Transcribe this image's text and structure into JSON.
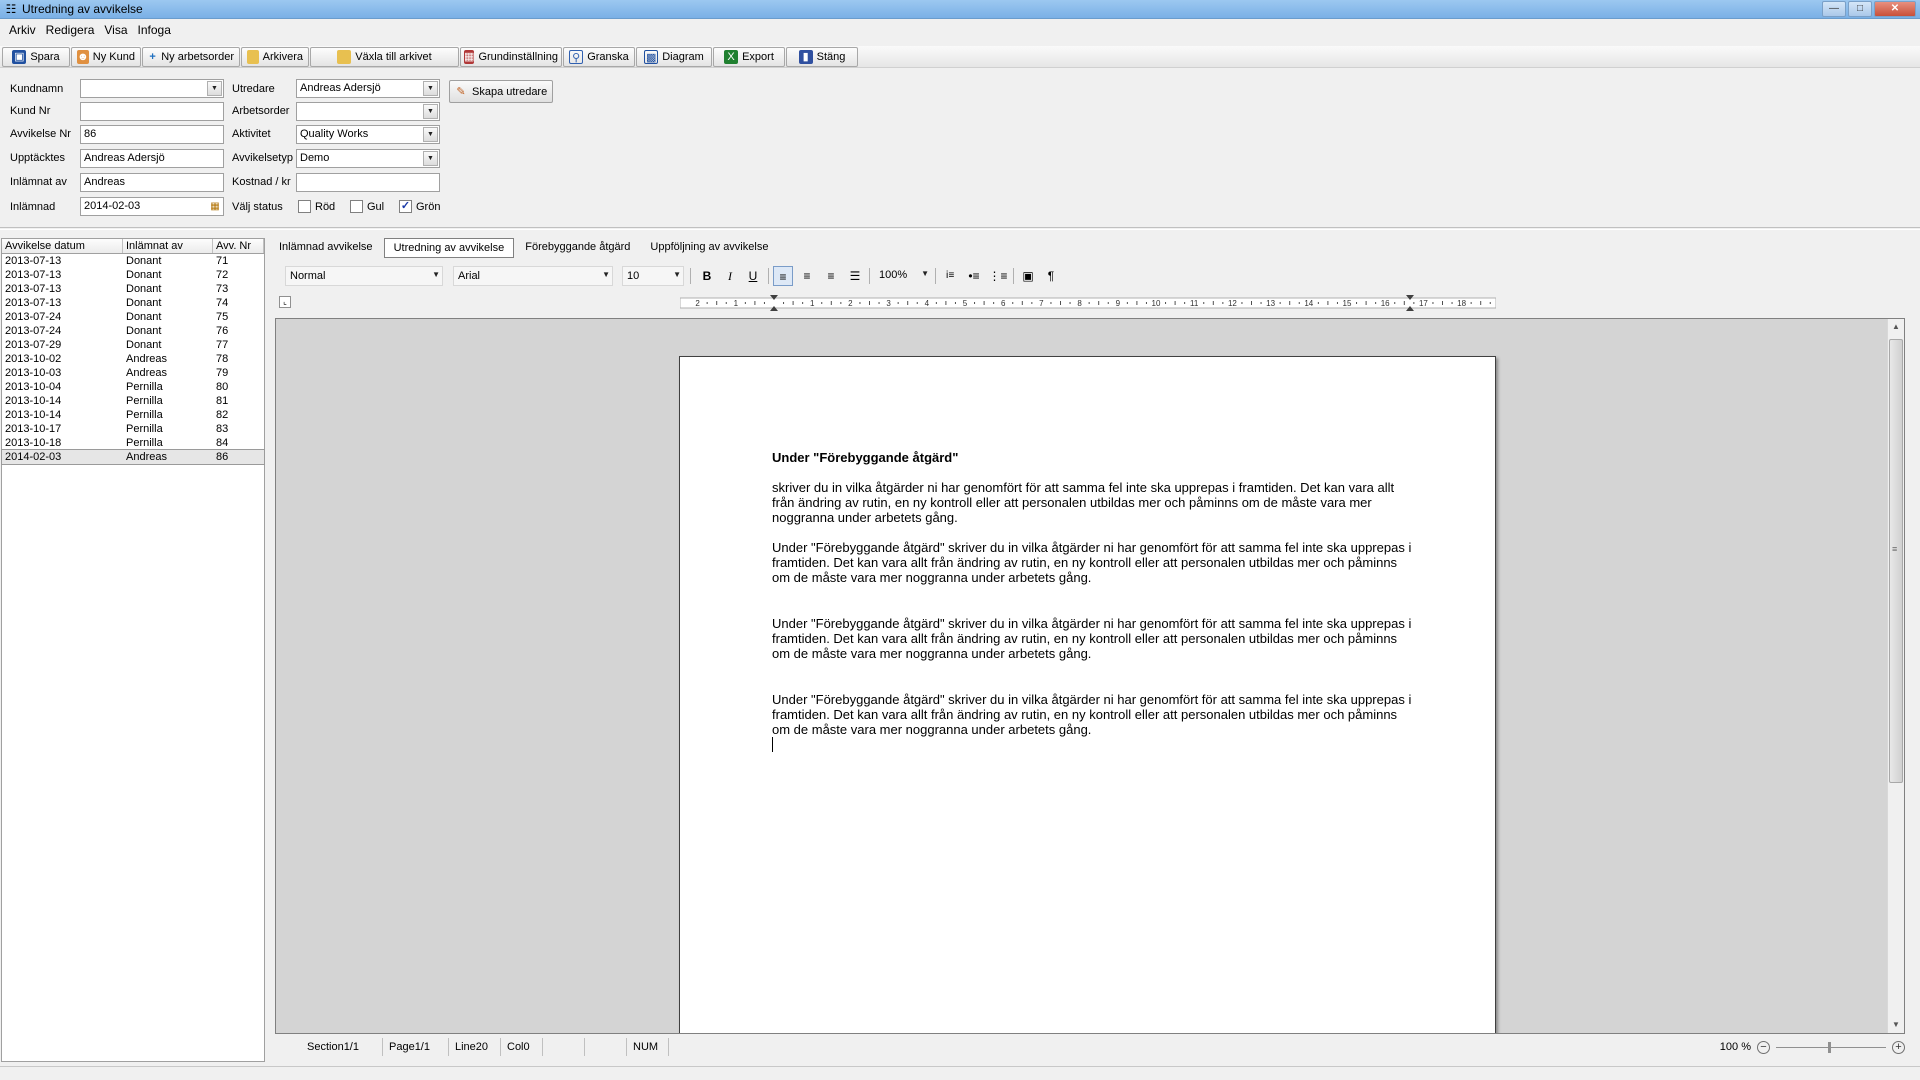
{
  "window": {
    "title": "Utredning av avvikelse",
    "app_icon": "document-search-icon",
    "controls": {
      "minimize": "minimize-icon",
      "maximize": "maximize-icon",
      "close": "close-icon"
    }
  },
  "menu": [
    "Arkiv",
    "Redigera",
    "Visa",
    "Infoga"
  ],
  "toolbar": [
    {
      "label": "Spara",
      "icon": "floppy-disk-icon",
      "color": "#2050a0"
    },
    {
      "label": "Ny Kund",
      "icon": "users-icon",
      "color": "#c06020"
    },
    {
      "label": "Ny arbetsorder",
      "icon": "plus-icon",
      "color": "#2070c0"
    },
    {
      "label": "Arkivera",
      "icon": "folder-icon",
      "color": "#d0a020"
    },
    {
      "label": "Växla till arkivet",
      "icon": "folder-open-icon",
      "color": "#d0a020"
    },
    {
      "label": "Grundinställning",
      "icon": "settings-book-icon",
      "color": "#a03030"
    },
    {
      "label": "Granska",
      "icon": "magnifier-icon",
      "color": "#3060b0"
    },
    {
      "label": "Diagram",
      "icon": "chart-icon",
      "color": "#2050a0"
    },
    {
      "label": "Export",
      "icon": "excel-icon",
      "color": "#208030"
    },
    {
      "label": "Stäng",
      "icon": "exit-door-icon",
      "color": "#3050a0"
    }
  ],
  "form": {
    "kundnamn": {
      "label": "Kundnamn",
      "value": ""
    },
    "kund_nr": {
      "label": "Kund Nr",
      "value": ""
    },
    "avvikelse_nr": {
      "label": "Avvikelse Nr",
      "value": "86"
    },
    "upptacktes": {
      "label": "Upptäcktes",
      "value": "Andreas Adersjö"
    },
    "inlamnat_av": {
      "label": "Inlämnat av",
      "value": "Andreas"
    },
    "inlamnad": {
      "label": "Inlämnad",
      "value": "2014-02-03"
    },
    "utredare": {
      "label": "Utredare",
      "value": "Andreas Adersjö"
    },
    "arbetsorder": {
      "label": "Arbetsorder",
      "value": ""
    },
    "aktivitet": {
      "label": "Aktivitet",
      "value": "Quality Works"
    },
    "avvikelsetyp": {
      "label": "Avvikelsetyp",
      "value": "Demo"
    },
    "kostnad": {
      "label": "Kostnad / kr",
      "value": ""
    },
    "status": {
      "label": "Välj status",
      "options": [
        {
          "label": "Röd",
          "checked": false
        },
        {
          "label": "Gul",
          "checked": false
        },
        {
          "label": "Grön",
          "checked": true
        }
      ]
    },
    "skapa_utredare": "Skapa utredare"
  },
  "list": {
    "headers": [
      "Avvikelse datum",
      "Inlämnat av",
      "Avv. Nr"
    ],
    "rows": [
      [
        "2013-07-13",
        "Donant",
        "71"
      ],
      [
        "2013-07-13",
        "Donant",
        "72"
      ],
      [
        "2013-07-13",
        "Donant",
        "73"
      ],
      [
        "2013-07-13",
        "Donant",
        "74"
      ],
      [
        "2013-07-24",
        "Donant",
        "75"
      ],
      [
        "2013-07-24",
        "Donant",
        "76"
      ],
      [
        "2013-07-29",
        "Donant",
        "77"
      ],
      [
        "2013-10-02",
        "Andreas",
        "78"
      ],
      [
        "2013-10-03",
        "Andreas",
        "79"
      ],
      [
        "2013-10-04",
        "Pernilla",
        "80"
      ],
      [
        "2013-10-14",
        "Pernilla",
        "81"
      ],
      [
        "2013-10-14",
        "Pernilla",
        "82"
      ],
      [
        "2013-10-17",
        "Pernilla",
        "83"
      ],
      [
        "2013-10-18",
        "Pernilla",
        "84"
      ],
      [
        "2014-02-03",
        "Andreas",
        "86"
      ]
    ],
    "selected_index": 14
  },
  "tabs": [
    {
      "label": "Inlämnad avvikelse",
      "active": false
    },
    {
      "label": "Utredning av avvikelse",
      "active": true
    },
    {
      "label": "Förebyggande åtgärd",
      "active": false
    },
    {
      "label": "Uppföljning av avvikelse",
      "active": false
    }
  ],
  "editor_toolbar": {
    "style": "Normal",
    "font": "Arial",
    "size": "10",
    "zoom": "100%"
  },
  "ruler_labels": [
    "2",
    "1",
    "1",
    "2",
    "3",
    "4",
    "5",
    "6",
    "7",
    "8",
    "9",
    "10",
    "11",
    "12",
    "13",
    "14",
    "15",
    "16",
    "17",
    "18"
  ],
  "document": {
    "heading": "Under \"Förebyggande åtgärd\"",
    "paragraphs": [
      " skriver du in vilka åtgärder ni har genomfört för att samma fel inte ska upprepas i framtiden. Det kan vara allt från ändring av rutin, en ny kontroll eller att personalen utbildas mer och påminns om de måste vara mer noggranna under arbetets gång.",
      "Under \"Förebyggande åtgärd\" skriver du in vilka åtgärder ni har genomfört för att samma fel inte ska upprepas i framtiden. Det kan vara allt från ändring av rutin, en ny kontroll eller att personalen utbildas mer och påminns om de måste vara mer noggranna under arbetets gång.",
      "Under \"Förebyggande åtgärd\" skriver du in vilka åtgärder ni har genomfört för att samma fel inte ska upprepas i framtiden. Det kan vara allt från ändring av rutin, en ny kontroll eller att personalen utbildas mer och påminns om de måste vara mer noggranna under arbetets gång.",
      "Under \"Förebyggande åtgärd\" skriver du in vilka åtgärder ni har genomfört för att samma fel inte ska upprepas i framtiden. Det kan vara allt från ändring av rutin, en ny kontroll eller att personalen utbildas mer och påminns om de måste vara mer noggranna under arbetets gång."
    ]
  },
  "status_bar": {
    "section": "Section1/1",
    "page": "Page1/1",
    "line": "Line20",
    "col": "Col0",
    "num": "NUM",
    "zoom": "100 %"
  }
}
